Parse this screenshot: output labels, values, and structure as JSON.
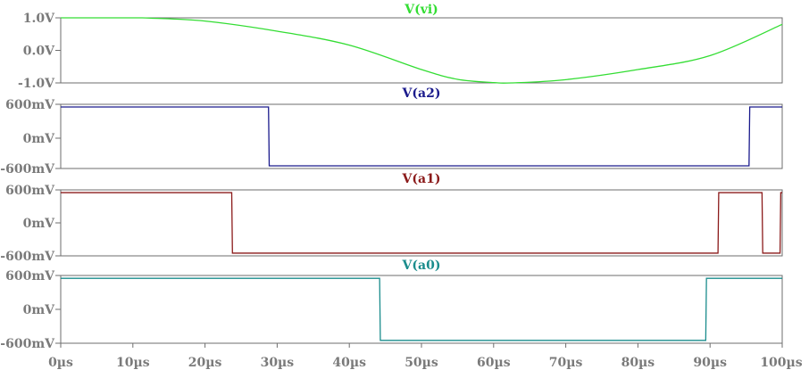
{
  "chart_data": [
    {
      "type": "line",
      "title": "V(vi)",
      "color": "#33dd33",
      "y_tick_labels": [
        "1.0V",
        "0.0V",
        "-1.0V"
      ],
      "y_ticks": [
        1.0,
        0.0,
        -1.0
      ],
      "ylim": [
        -1.0,
        1.0
      ],
      "xlim": [
        0,
        100
      ],
      "series": [
        {
          "x": [
            0,
            10,
            12.5,
            20,
            30,
            40,
            50,
            55,
            60,
            62.5,
            70,
            80,
            90,
            100
          ],
          "values": [
            1.0,
            1.0,
            0.99,
            0.9,
            0.59,
            0.16,
            -0.59,
            -0.89,
            -0.99,
            -1.0,
            -0.9,
            -0.59,
            -0.16,
            0.8
          ]
        }
      ]
    },
    {
      "type": "line",
      "title": "V(a2)",
      "color": "#1a1a8c",
      "y_tick_labels": [
        "600mV",
        "0mV",
        "-600mV"
      ],
      "y_ticks": [
        600,
        0,
        -600
      ],
      "ylim": [
        -700,
        600
      ],
      "xlim": [
        0,
        100
      ],
      "series": [
        {
          "x": [
            0,
            28.8,
            28.9,
            95.4,
            95.5,
            100
          ],
          "values": [
            550,
            550,
            -550,
            -550,
            550,
            550
          ]
        }
      ]
    },
    {
      "type": "line",
      "title": "V(a1)",
      "color": "#8b1a1a",
      "y_tick_labels": [
        "600mV",
        "0mV",
        "-600mV"
      ],
      "y_ticks": [
        600,
        0,
        -600
      ],
      "ylim": [
        -700,
        600
      ],
      "xlim": [
        0,
        100
      ],
      "series": [
        {
          "x": [
            0,
            23.7,
            23.8,
            91.1,
            91.2,
            97.2,
            97.3,
            99.7,
            99.8,
            100
          ],
          "values": [
            550,
            550,
            -550,
            -550,
            550,
            550,
            -550,
            -550,
            550,
            550
          ]
        }
      ]
    },
    {
      "type": "line",
      "title": "V(a0)",
      "color": "#1a8c8c",
      "y_tick_labels": [
        "600mV",
        "0mV",
        "-600mV"
      ],
      "y_ticks": [
        600,
        0,
        -600
      ],
      "ylim": [
        -700,
        600
      ],
      "xlim": [
        0,
        100
      ],
      "series": [
        {
          "x": [
            0,
            44.2,
            44.3,
            89.4,
            89.5,
            100
          ],
          "values": [
            550,
            550,
            -550,
            -550,
            550,
            550
          ]
        }
      ]
    }
  ],
  "x_axis": {
    "tick_values": [
      0,
      10,
      20,
      30,
      40,
      50,
      60,
      70,
      80,
      90,
      100
    ],
    "tick_labels": [
      "0µs",
      "10µs",
      "20µs",
      "30µs",
      "40µs",
      "50µs",
      "60µs",
      "70µs",
      "80µs",
      "90µs",
      "100µs"
    ]
  }
}
